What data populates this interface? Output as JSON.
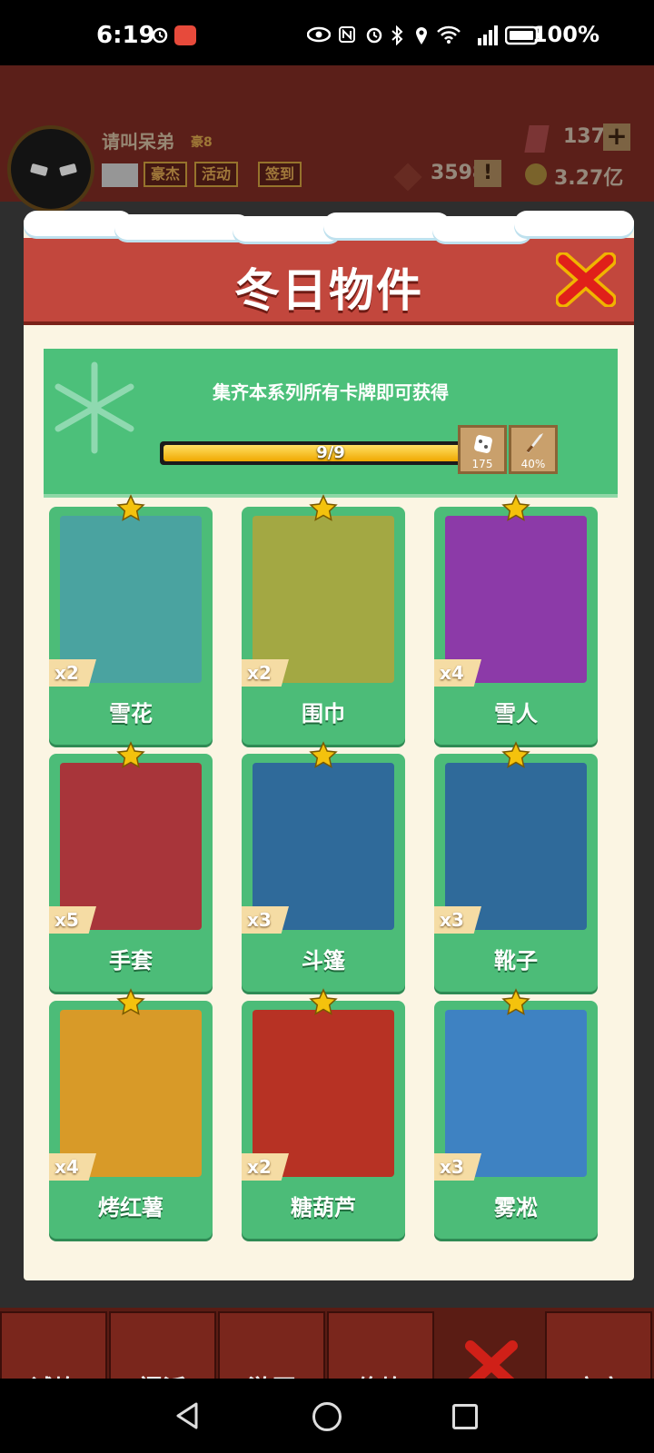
{
  "status_bar": {
    "time": "6:19",
    "battery": "100%"
  },
  "profile": {
    "name": "请叫呆弟",
    "rank": "豪8"
  },
  "top_buttons": {
    "hero": "豪杰",
    "activity": "活动",
    "checkin": "签到"
  },
  "currency": {
    "gems": "1374",
    "honor": "3598",
    "coins": "3.27亿"
  },
  "modal": {
    "title": "冬日物件",
    "banner_text": "集齐本系列所有卡牌即可获得",
    "progress_text": "9/9",
    "progress_fraction": 1.0,
    "rewards": [
      {
        "icon": "dice-icon",
        "label": "175"
      },
      {
        "icon": "sword-icon",
        "label": "40%"
      }
    ]
  },
  "cards": [
    {
      "name": "雪花",
      "count": "x2",
      "art": "snowflake",
      "color": "#4aa3a0"
    },
    {
      "name": "围巾",
      "count": "x2",
      "art": "scarf",
      "color": "#a3a843"
    },
    {
      "name": "雪人",
      "count": "x4",
      "art": "snowman",
      "color": "#8c3aa8"
    },
    {
      "name": "手套",
      "count": "x5",
      "art": "gloves",
      "color": "#a8353a"
    },
    {
      "name": "斗篷",
      "count": "x3",
      "art": "cloak",
      "color": "#2f6a9a"
    },
    {
      "name": "靴子",
      "count": "x3",
      "art": "boots",
      "color": "#2f6a9a"
    },
    {
      "name": "烤红薯",
      "count": "x4",
      "art": "sweet-potato",
      "color": "#d89a28"
    },
    {
      "name": "糖葫芦",
      "count": "x2",
      "art": "candied-haws",
      "color": "#b73224"
    },
    {
      "name": "雾凇",
      "count": "x3",
      "art": "rime",
      "color": "#3e82c2"
    }
  ],
  "bottom_nav": [
    {
      "label": "试炼"
    },
    {
      "label": "门派"
    },
    {
      "label": "游历"
    },
    {
      "label": "修炼"
    },
    {
      "label": "商店"
    }
  ]
}
